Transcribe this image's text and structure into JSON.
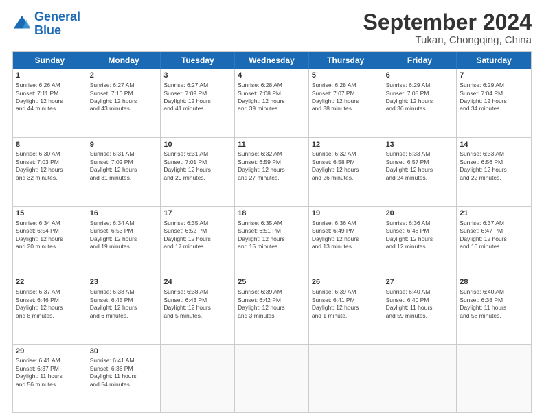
{
  "logo": {
    "line1": "General",
    "line2": "Blue"
  },
  "title": "September 2024",
  "location": "Tukan, Chongqing, China",
  "header_days": [
    "Sunday",
    "Monday",
    "Tuesday",
    "Wednesday",
    "Thursday",
    "Friday",
    "Saturday"
  ],
  "weeks": [
    [
      {
        "day": "1",
        "lines": [
          "Sunrise: 6:26 AM",
          "Sunset: 7:11 PM",
          "Daylight: 12 hours",
          "and 44 minutes."
        ]
      },
      {
        "day": "2",
        "lines": [
          "Sunrise: 6:27 AM",
          "Sunset: 7:10 PM",
          "Daylight: 12 hours",
          "and 43 minutes."
        ]
      },
      {
        "day": "3",
        "lines": [
          "Sunrise: 6:27 AM",
          "Sunset: 7:09 PM",
          "Daylight: 12 hours",
          "and 41 minutes."
        ]
      },
      {
        "day": "4",
        "lines": [
          "Sunrise: 6:28 AM",
          "Sunset: 7:08 PM",
          "Daylight: 12 hours",
          "and 39 minutes."
        ]
      },
      {
        "day": "5",
        "lines": [
          "Sunrise: 6:28 AM",
          "Sunset: 7:07 PM",
          "Daylight: 12 hours",
          "and 38 minutes."
        ]
      },
      {
        "day": "6",
        "lines": [
          "Sunrise: 6:29 AM",
          "Sunset: 7:05 PM",
          "Daylight: 12 hours",
          "and 36 minutes."
        ]
      },
      {
        "day": "7",
        "lines": [
          "Sunrise: 6:29 AM",
          "Sunset: 7:04 PM",
          "Daylight: 12 hours",
          "and 34 minutes."
        ]
      }
    ],
    [
      {
        "day": "8",
        "lines": [
          "Sunrise: 6:30 AM",
          "Sunset: 7:03 PM",
          "Daylight: 12 hours",
          "and 32 minutes."
        ]
      },
      {
        "day": "9",
        "lines": [
          "Sunrise: 6:31 AM",
          "Sunset: 7:02 PM",
          "Daylight: 12 hours",
          "and 31 minutes."
        ]
      },
      {
        "day": "10",
        "lines": [
          "Sunrise: 6:31 AM",
          "Sunset: 7:01 PM",
          "Daylight: 12 hours",
          "and 29 minutes."
        ]
      },
      {
        "day": "11",
        "lines": [
          "Sunrise: 6:32 AM",
          "Sunset: 6:59 PM",
          "Daylight: 12 hours",
          "and 27 minutes."
        ]
      },
      {
        "day": "12",
        "lines": [
          "Sunrise: 6:32 AM",
          "Sunset: 6:58 PM",
          "Daylight: 12 hours",
          "and 26 minutes."
        ]
      },
      {
        "day": "13",
        "lines": [
          "Sunrise: 6:33 AM",
          "Sunset: 6:57 PM",
          "Daylight: 12 hours",
          "and 24 minutes."
        ]
      },
      {
        "day": "14",
        "lines": [
          "Sunrise: 6:33 AM",
          "Sunset: 6:56 PM",
          "Daylight: 12 hours",
          "and 22 minutes."
        ]
      }
    ],
    [
      {
        "day": "15",
        "lines": [
          "Sunrise: 6:34 AM",
          "Sunset: 6:54 PM",
          "Daylight: 12 hours",
          "and 20 minutes."
        ]
      },
      {
        "day": "16",
        "lines": [
          "Sunrise: 6:34 AM",
          "Sunset: 6:53 PM",
          "Daylight: 12 hours",
          "and 19 minutes."
        ]
      },
      {
        "day": "17",
        "lines": [
          "Sunrise: 6:35 AM",
          "Sunset: 6:52 PM",
          "Daylight: 12 hours",
          "and 17 minutes."
        ]
      },
      {
        "day": "18",
        "lines": [
          "Sunrise: 6:35 AM",
          "Sunset: 6:51 PM",
          "Daylight: 12 hours",
          "and 15 minutes."
        ]
      },
      {
        "day": "19",
        "lines": [
          "Sunrise: 6:36 AM",
          "Sunset: 6:49 PM",
          "Daylight: 12 hours",
          "and 13 minutes."
        ]
      },
      {
        "day": "20",
        "lines": [
          "Sunrise: 6:36 AM",
          "Sunset: 6:48 PM",
          "Daylight: 12 hours",
          "and 12 minutes."
        ]
      },
      {
        "day": "21",
        "lines": [
          "Sunrise: 6:37 AM",
          "Sunset: 6:47 PM",
          "Daylight: 12 hours",
          "and 10 minutes."
        ]
      }
    ],
    [
      {
        "day": "22",
        "lines": [
          "Sunrise: 6:37 AM",
          "Sunset: 6:46 PM",
          "Daylight: 12 hours",
          "and 8 minutes."
        ]
      },
      {
        "day": "23",
        "lines": [
          "Sunrise: 6:38 AM",
          "Sunset: 6:45 PM",
          "Daylight: 12 hours",
          "and 6 minutes."
        ]
      },
      {
        "day": "24",
        "lines": [
          "Sunrise: 6:38 AM",
          "Sunset: 6:43 PM",
          "Daylight: 12 hours",
          "and 5 minutes."
        ]
      },
      {
        "day": "25",
        "lines": [
          "Sunrise: 6:39 AM",
          "Sunset: 6:42 PM",
          "Daylight: 12 hours",
          "and 3 minutes."
        ]
      },
      {
        "day": "26",
        "lines": [
          "Sunrise: 6:39 AM",
          "Sunset: 6:41 PM",
          "Daylight: 12 hours",
          "and 1 minute."
        ]
      },
      {
        "day": "27",
        "lines": [
          "Sunrise: 6:40 AM",
          "Sunset: 6:40 PM",
          "Daylight: 11 hours",
          "and 59 minutes."
        ]
      },
      {
        "day": "28",
        "lines": [
          "Sunrise: 6:40 AM",
          "Sunset: 6:38 PM",
          "Daylight: 11 hours",
          "and 58 minutes."
        ]
      }
    ],
    [
      {
        "day": "29",
        "lines": [
          "Sunrise: 6:41 AM",
          "Sunset: 6:37 PM",
          "Daylight: 11 hours",
          "and 56 minutes."
        ]
      },
      {
        "day": "30",
        "lines": [
          "Sunrise: 6:41 AM",
          "Sunset: 6:36 PM",
          "Daylight: 11 hours",
          "and 54 minutes."
        ]
      },
      {
        "day": "",
        "lines": []
      },
      {
        "day": "",
        "lines": []
      },
      {
        "day": "",
        "lines": []
      },
      {
        "day": "",
        "lines": []
      },
      {
        "day": "",
        "lines": []
      }
    ]
  ]
}
